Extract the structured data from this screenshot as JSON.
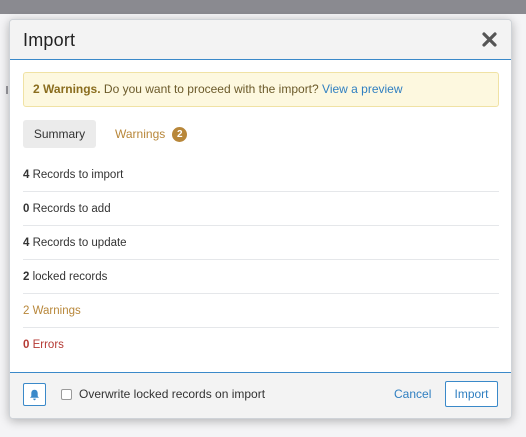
{
  "dialog": {
    "title": "Import",
    "close_icon": "close-icon"
  },
  "alert": {
    "strong": "2 Warnings.",
    "message": " Do you want to proceed with the import? ",
    "link": "View a preview"
  },
  "tabs": {
    "summary": "Summary",
    "warnings": "Warnings",
    "warnings_count": "2"
  },
  "summary": [
    {
      "num": "4",
      "text": " Records to import",
      "type": "normal"
    },
    {
      "num": "0",
      "text": " Records to add",
      "type": "normal"
    },
    {
      "num": "4",
      "text": " Records to update",
      "type": "normal"
    },
    {
      "num": "2",
      "text": " locked records",
      "type": "normal"
    },
    {
      "num": "2",
      "text": " Warnings",
      "type": "warn"
    },
    {
      "num": "0",
      "text": " Errors",
      "type": "err"
    }
  ],
  "footer": {
    "bell_icon": "bell-icon",
    "overwrite_label": "Overwrite locked records on import",
    "overwrite_checked": false,
    "cancel_label": "Cancel",
    "import_label": "Import"
  },
  "colors": {
    "accent": "#3a89c9",
    "link": "#2f7fc1",
    "warning": "#b8873a",
    "error": "#b53a34",
    "alert_bg": "#fdf8df"
  }
}
